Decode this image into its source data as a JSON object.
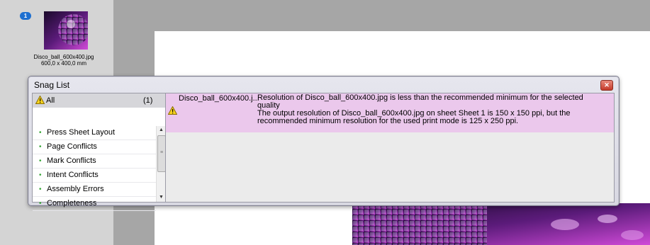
{
  "thumbnail": {
    "page_number": "1",
    "file_name": "Disco_ball_600x400.jpg",
    "dimensions": "600,0 x 400,0 mm"
  },
  "snag_list": {
    "title": "Snag List",
    "close_icon": "close-icon",
    "all_item": {
      "label": "All",
      "count": "(1)"
    },
    "categories": [
      {
        "label": "Press Sheet Layout"
      },
      {
        "label": "Page Conflicts"
      },
      {
        "label": "Mark Conflicts"
      },
      {
        "label": "Intent Conflicts"
      },
      {
        "label": "Assembly Errors"
      },
      {
        "label": "Completeness"
      }
    ],
    "issues": [
      {
        "file": "Disco_ball_600x400.j...",
        "message_line1": "Resolution of Disco_ball_600x400.jpg is less than the recommended minimum for the selected",
        "message_line2": "quality",
        "message_line3": "The output resolution of Disco_ball_600x400.jpg on sheet Sheet 1 is 150 x 150 ppi, but the",
        "message_line4": "recommended minimum resolution for the used print mode is 125 x 250 ppi."
      }
    ]
  },
  "colors": {
    "issue_highlight": "#ebc8ec",
    "warning_yellow": "#f5d21e",
    "bullet_green": "#3aa83a",
    "badge_blue": "#1e6fd0"
  }
}
